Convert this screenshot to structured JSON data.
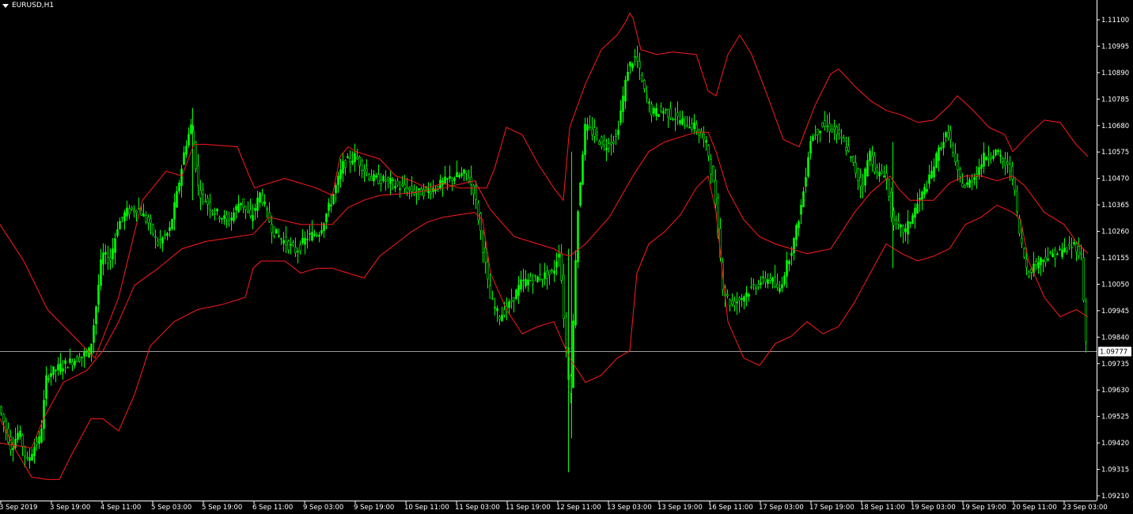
{
  "symbol": {
    "label": "EURUSD,H1"
  },
  "colors": {
    "background": "#000000",
    "bull": "#00ff00",
    "band": "#ff1a1a",
    "axis": "#ffffff",
    "current_line": "#9a9a9a",
    "current_bg": "#ffffff",
    "current_text": "#000000"
  },
  "price_axis": {
    "labels": [
      "1.11100",
      "1.10995",
      "1.10890",
      "1.10785",
      "1.10680",
      "1.10575",
      "1.10470",
      "1.10365",
      "1.10260",
      "1.10155",
      "1.10050",
      "1.09945",
      "1.09840",
      "1.09735",
      "1.09630",
      "1.09525",
      "1.09420",
      "1.09315",
      "1.09210"
    ],
    "current_price": "1.09777"
  },
  "time_axis": {
    "labels": [
      "3 Sep 2019",
      "3 Sep 19:00",
      "4 Sep 11:00",
      "5 Sep 03:00",
      "5 Sep 19:00",
      "6 Sep 11:00",
      "9 Sep 03:00",
      "9 Sep 19:00",
      "10 Sep 11:00",
      "11 Sep 03:00",
      "11 Sep 19:00",
      "12 Sep 11:00",
      "13 Sep 03:00",
      "13 Sep 19:00",
      "16 Sep 11:00",
      "17 Sep 03:00",
      "17 Sep 19:00",
      "18 Sep 11:00",
      "19 Sep 03:00",
      "19 Sep 19:00",
      "20 Sep 11:00",
      "23 Sep 03:00"
    ]
  },
  "chart_data": {
    "type": "line",
    "title": "EURUSD,H1",
    "xlabel": "",
    "ylabel": "",
    "ylim": [
      1.0918,
      1.1118
    ],
    "grid": false,
    "series": [
      {
        "role": "close",
        "x": [
          0,
          15,
          25,
          35,
          45,
          52,
          60,
          80,
          100,
          115,
          122,
          130,
          140,
          150,
          160,
          175,
          190,
          200,
          215,
          225,
          235,
          243,
          252,
          270,
          290,
          305,
          318,
          330,
          345,
          360,
          375,
          390,
          405,
          420,
          435,
          450,
          470,
          490,
          510,
          530,
          550,
          570,
          590,
          600,
          610,
          620,
          632,
          645,
          660,
          680,
          700,
          708,
          715,
          722,
          730,
          740,
          750,
          765,
          780,
          795,
          805,
          815,
          825,
          840,
          860,
          880,
          895,
          905,
          915,
          925,
          935,
          945,
          960,
          975,
          985,
          995,
          1005,
          1015,
          1025,
          1040,
          1055,
          1070,
          1080,
          1090,
          1100,
          1110,
          1120,
          1128,
          1135,
          1145,
          1160,
          1175,
          1190,
          1200,
          1210,
          1220,
          1235,
          1245,
          1260,
          1270,
          1280,
          1290,
          1300,
          1310,
          1320,
          1335,
          1350,
          1360,
          1368,
          1374
        ],
        "y": [
          1.0955,
          1.0938,
          1.0945,
          1.0932,
          1.0939,
          1.0942,
          1.0968,
          1.0972,
          1.0975,
          1.0978,
          1.0995,
          1.1018,
          1.1015,
          1.103,
          1.1035,
          1.1037,
          1.103,
          1.1022,
          1.1027,
          1.1043,
          1.1062,
          1.1071,
          1.1044,
          1.1036,
          1.1031,
          1.104,
          1.1032,
          1.1043,
          1.1028,
          1.1023,
          1.1019,
          1.1025,
          1.1027,
          1.104,
          1.1055,
          1.1058,
          1.1049,
          1.1048,
          1.1045,
          1.1043,
          1.1045,
          1.1049,
          1.1051,
          1.1044,
          1.1024,
          1.1,
          1.0992,
          1.0997,
          1.1006,
          1.1008,
          1.101,
          1.102,
          1.0985,
          1.0958,
          1.103,
          1.107,
          1.1068,
          1.1062,
          1.1066,
          1.1095,
          1.1099,
          1.1085,
          1.1076,
          1.1077,
          1.1073,
          1.107,
          1.1062,
          1.1041,
          1.1003,
          1.0997,
          1.0999,
          1.1002,
          1.1006,
          1.1008,
          1.1002,
          1.1013,
          1.1024,
          1.104,
          1.1065,
          1.1071,
          1.1069,
          1.1062,
          1.1054,
          1.1045,
          1.106,
          1.105,
          1.1052,
          1.1033,
          1.1029,
          1.1027,
          1.1038,
          1.1048,
          1.1063,
          1.1068,
          1.1052,
          1.1045,
          1.1051,
          1.1058,
          1.106,
          1.1055,
          1.1052,
          1.1025,
          1.101,
          1.1014,
          1.1016,
          1.1018,
          1.102,
          1.1022,
          1.1016,
          1.0978
        ]
      },
      {
        "role": "band-upper",
        "x": [
          0,
          30,
          60,
          90,
          120,
          150,
          180,
          210,
          230,
          245,
          260,
          300,
          315,
          322,
          330,
          360,
          400,
          420,
          430,
          440,
          450,
          480,
          500,
          520,
          540,
          560,
          580,
          600,
          615,
          625,
          640,
          660,
          680,
          700,
          712,
          720,
          740,
          760,
          780,
          790,
          796,
          800,
          810,
          830,
          850,
          880,
          895,
          905,
          920,
          935,
          950,
          970,
          990,
          1010,
          1030,
          1050,
          1060,
          1080,
          1100,
          1120,
          1140,
          1160,
          1180,
          1200,
          1210,
          1230,
          1250,
          1270,
          1280,
          1300,
          1320,
          1340,
          1360,
          1375
        ],
        "y": [
          1.103,
          1.1015,
          1.0995,
          1.0985,
          1.0975,
          1.1,
          1.104,
          1.1052,
          1.105,
          1.1063,
          1.1063,
          1.1062,
          1.105,
          1.1045,
          1.1046,
          1.1049,
          1.1045,
          1.1042,
          1.1058,
          1.1062,
          1.106,
          1.1057,
          1.105,
          1.1048,
          1.1045,
          1.1047,
          1.1045,
          1.1045,
          1.1045,
          1.1053,
          1.107,
          1.1067,
          1.1055,
          1.1045,
          1.104,
          1.107,
          1.1088,
          1.1102,
          1.1108,
          1.1113,
          1.1117,
          1.1115,
          1.1102,
          1.11,
          1.1101,
          1.11,
          1.1085,
          1.1083,
          1.11,
          1.1108,
          1.11,
          1.1083,
          1.1065,
          1.1062,
          1.1079,
          1.1092,
          1.1094,
          1.1087,
          1.1081,
          1.1077,
          1.1075,
          1.1072,
          1.1073,
          1.1079,
          1.1083,
          1.1077,
          1.107,
          1.1067,
          1.106,
          1.1067,
          1.1073,
          1.1072,
          1.1063,
          1.1058
        ]
      },
      {
        "role": "band-middle",
        "x": [
          0,
          20,
          40,
          55,
          80,
          110,
          130,
          150,
          170,
          200,
          230,
          260,
          300,
          320,
          340,
          380,
          420,
          440,
          460,
          480,
          520,
          560,
          600,
          620,
          650,
          680,
          700,
          710,
          720,
          740,
          770,
          800,
          820,
          840,
          860,
          880,
          895,
          905,
          920,
          940,
          960,
          980,
          1000,
          1020,
          1050,
          1080,
          1100,
          1125,
          1135,
          1150,
          1180,
          1200,
          1220,
          1240,
          1260,
          1280,
          1295,
          1320,
          1345,
          1360,
          1375
        ],
        "y": [
          1.094,
          1.0939,
          1.0938,
          1.095,
          1.0965,
          1.097,
          1.0978,
          1.099,
          1.1005,
          1.1012,
          1.102,
          1.1023,
          1.1025,
          1.1026,
          1.1033,
          1.103,
          1.103,
          1.1037,
          1.104,
          1.1042,
          1.1043,
          1.1045,
          1.1048,
          1.1036,
          1.1025,
          1.1022,
          1.102,
          1.1018,
          1.1017,
          1.1022,
          1.1033,
          1.105,
          1.106,
          1.1064,
          1.1066,
          1.1068,
          1.1068,
          1.106,
          1.1044,
          1.1032,
          1.1025,
          1.1022,
          1.102,
          1.1018,
          1.102,
          1.1035,
          1.1043,
          1.105,
          1.1045,
          1.104,
          1.104,
          1.1047,
          1.105,
          1.105,
          1.1048,
          1.105,
          1.1046,
          1.1035,
          1.103,
          1.1023,
          1.1018
        ]
      },
      {
        "role": "band-lower",
        "x": [
          0,
          20,
          40,
          60,
          75,
          90,
          115,
          130,
          150,
          170,
          190,
          220,
          250,
          280,
          310,
          320,
          330,
          360,
          380,
          400,
          420,
          440,
          460,
          480,
          500,
          520,
          540,
          560,
          580,
          600,
          610,
          620,
          640,
          660,
          680,
          700,
          720,
          740,
          760,
          780,
          796,
          805,
          820,
          840,
          860,
          880,
          895,
          905,
          920,
          940,
          960,
          980,
          1000,
          1020,
          1040,
          1060,
          1080,
          1100,
          1120,
          1140,
          1160,
          1180,
          1200,
          1220,
          1240,
          1260,
          1280,
          1290,
          1300,
          1320,
          1340,
          1360,
          1375
        ],
        "y": [
          1.095,
          1.0937,
          1.0926,
          1.0925,
          1.0925,
          1.0935,
          1.095,
          1.095,
          1.0945,
          1.096,
          1.098,
          1.099,
          1.0995,
          1.0997,
          1.1,
          1.1012,
          1.1015,
          1.1015,
          1.101,
          1.1012,
          1.1012,
          1.101,
          1.1008,
          1.1017,
          1.1022,
          1.1027,
          1.1031,
          1.1033,
          1.1034,
          1.1035,
          1.1032,
          1.101,
          1.0995,
          1.0985,
          1.0988,
          1.099,
          1.0975,
          1.0965,
          1.0968,
          1.0975,
          1.0978,
          1.101,
          1.1022,
          1.1027,
          1.1034,
          1.1045,
          1.105,
          1.1035,
          1.099,
          1.0975,
          1.0972,
          1.0981,
          1.0984,
          1.099,
          1.0985,
          1.0988,
          1.0998,
          1.101,
          1.1022,
          1.1018,
          1.1015,
          1.1017,
          1.102,
          1.103,
          1.1033,
          1.1038,
          1.1035,
          1.1032,
          1.1015,
          1.1,
          1.0992,
          1.0995,
          1.0992
        ]
      }
    ]
  }
}
